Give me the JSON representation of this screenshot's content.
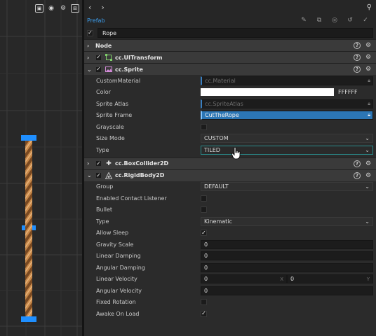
{
  "scene": {
    "toolbar": [
      {
        "name": "frame-icon",
        "glyph": "▣"
      },
      {
        "name": "eye-icon",
        "glyph": "◉"
      },
      {
        "name": "gear-icon",
        "glyph": "⚙"
      },
      {
        "name": "more-icon",
        "glyph": "⊞"
      }
    ]
  },
  "inspector": {
    "nav_back": "‹",
    "nav_forward": "›",
    "pin": "⚲",
    "prefab_label": "Prefab",
    "node_name": "Rope",
    "sections": {
      "node": "Node",
      "uitransform": "cc.UITransform",
      "sprite": "cc.Sprite",
      "boxcollider": "cc.BoxCollider2D",
      "rigidbody": "cc.RigidBody2D"
    },
    "sprite": {
      "custom_material_label": "CustomMaterial",
      "custom_material_value": "cc.Material",
      "color_label": "Color",
      "color_hex": "FFFFFF",
      "atlas_label": "Sprite Atlas",
      "atlas_value": "cc.SpriteAtlas",
      "frame_label": "Sprite Frame",
      "frame_value": "CutTheRope",
      "grayscale_label": "Grayscale",
      "size_mode_label": "Size Mode",
      "size_mode_value": "CUSTOM",
      "type_label": "Type",
      "type_value": "TILED"
    },
    "rigidbody": {
      "group_label": "Group",
      "group_value": "DEFAULT",
      "contact_label": "Enabled Contact Listener",
      "bullet_label": "Bullet",
      "type_label": "Type",
      "type_value": "Kinematic",
      "allow_sleep_label": "Allow Sleep",
      "gravity_label": "Gravity Scale",
      "gravity_value": "0",
      "lin_damp_label": "Linear Damping",
      "lin_damp_value": "0",
      "ang_damp_label": "Angular Damping",
      "ang_damp_value": "0",
      "lin_vel_label": "Linear Velocity",
      "lin_vel_x": "0",
      "lin_vel_y": "0",
      "axis_x": "X",
      "axis_y": "Y",
      "ang_vel_label": "Angular Velocity",
      "ang_vel_value": "0",
      "fixed_rot_label": "Fixed Rotation",
      "awake_label": "Awake On Load"
    }
  },
  "colors": {
    "accent_blue": "#2c76b5",
    "handle_blue": "#1f8fff",
    "rope": "#c58a4a"
  }
}
